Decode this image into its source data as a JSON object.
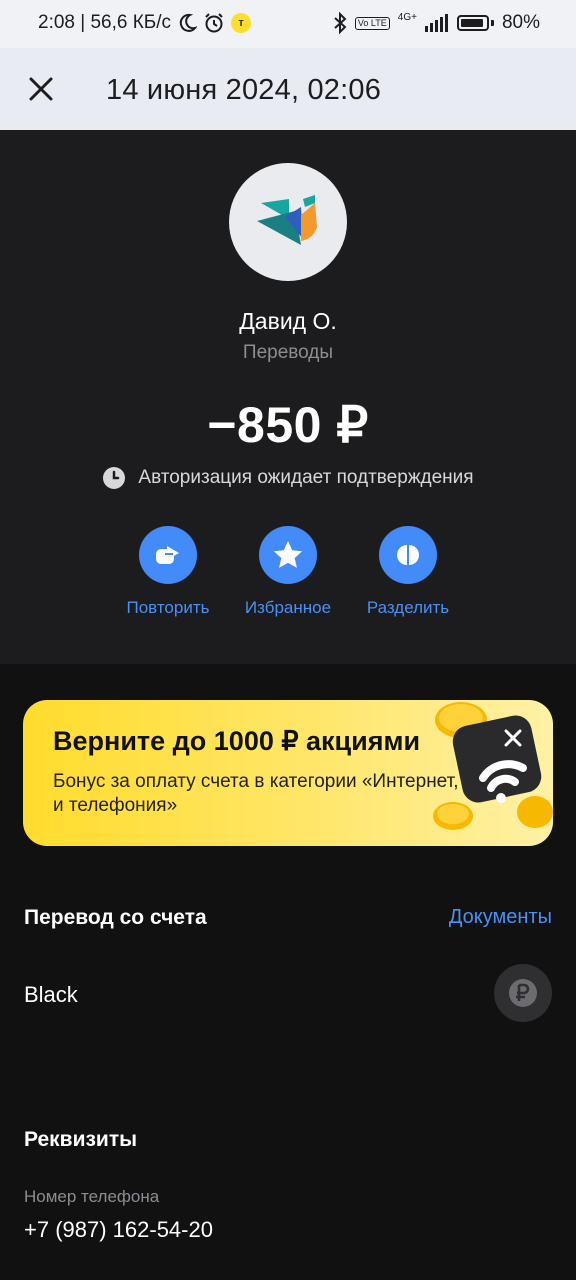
{
  "status_bar": {
    "time_and_speed": "2:08 | 56,6 КБ/с",
    "network": "4G+",
    "volte": "Vo LTE",
    "battery": "80%"
  },
  "header": {
    "title": "14 июня 2024, 02:06",
    "close_icon": "close-icon"
  },
  "operation": {
    "recipient": "Давид О.",
    "category": "Переводы",
    "amount": "−850 ₽",
    "status": "Авторизация ожидает подтверждения"
  },
  "actions": [
    {
      "label": "Повторить",
      "icon": "repeat-icon"
    },
    {
      "label": "Избранное",
      "icon": "star-icon"
    },
    {
      "label": "Разделить",
      "icon": "split-icon"
    }
  ],
  "promo": {
    "title": "Верните до 1000 ₽ акциями",
    "text": "Бонус за оплату счета в категории «Интернет, ТВ и телефония»"
  },
  "account_section": {
    "title": "Перевод со счета",
    "documents_link": "Документы",
    "account_name": "Black"
  },
  "details_section": {
    "title": "Реквизиты",
    "phone_label": "Номер телефона",
    "phone_value": "+7 (987) 162-54-20"
  },
  "colors": {
    "accent_blue": "#428bf9",
    "promo_yellow": "#ffdc2c",
    "hero_bg": "#1c1c1e",
    "page_bg": "#111112"
  }
}
